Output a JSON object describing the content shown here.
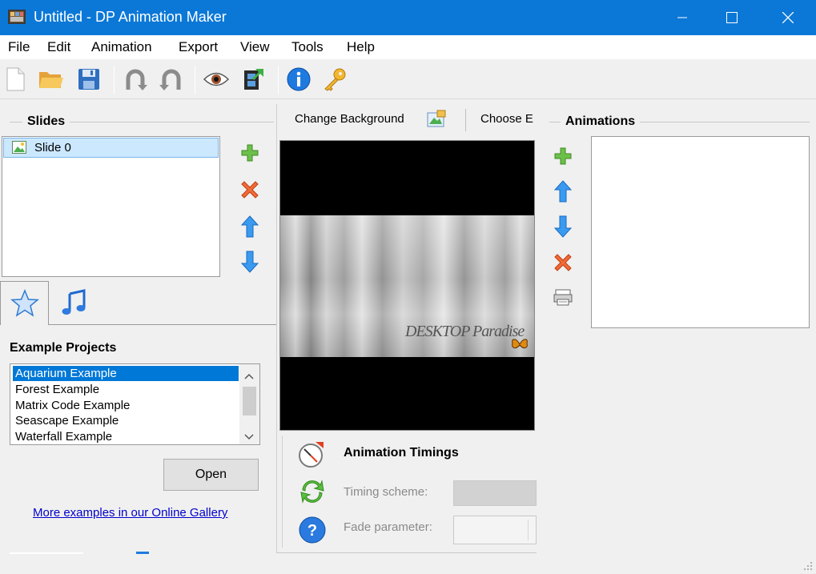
{
  "window": {
    "title": "Untitled - DP Animation Maker",
    "controls": {
      "minimize": "—",
      "maximize": "☐",
      "close": "✕"
    }
  },
  "menu": {
    "items": [
      "File",
      "Edit",
      "Animation",
      "Export",
      "View",
      "Tools",
      "Help"
    ]
  },
  "toolbar": {
    "buttons": [
      "new-document-icon",
      "open-folder-icon",
      "save-icon",
      "undo-icon",
      "redo-icon",
      "preview-eye-icon",
      "export-film-icon",
      "info-icon",
      "key-icon"
    ]
  },
  "slides": {
    "title": "Slides",
    "items": [
      "Slide 0"
    ]
  },
  "bottom_tabs": [
    "star-icon",
    "music-note-icon"
  ],
  "examples": {
    "title": "Example Projects",
    "items": [
      "Aquarium Example",
      "Forest Example",
      "Matrix Code Example",
      "Seascape Example",
      "Waterfall Example"
    ],
    "selected": 0,
    "open_label": "Open",
    "gallery_link": "More examples in our Online Gallery"
  },
  "center_toolbar": {
    "change_background": "Change Background",
    "choose_effect": "Choose E"
  },
  "preview": {
    "watermark_text": "DESKTOP Paradise"
  },
  "timings": {
    "title": "Animation Timings",
    "timing_scheme_label": "Timing scheme:",
    "fade_parameter_label": "Fade parameter:"
  },
  "animations": {
    "title": "Animations"
  },
  "colors": {
    "titlebar": "#0b78d7",
    "selection": "#0078d7",
    "link": "#0000cc"
  }
}
